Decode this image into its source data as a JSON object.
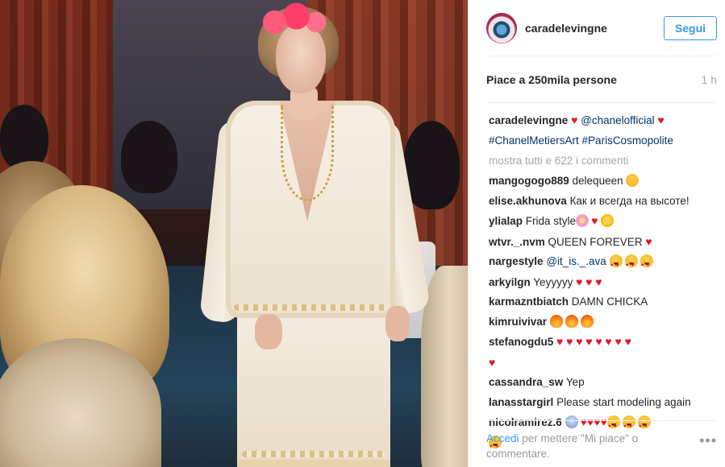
{
  "header": {
    "username": "caradelevingne",
    "follow_label": "Segui"
  },
  "likes": {
    "text": "Piace a 250mila persone",
    "time": "1 h"
  },
  "caption": {
    "username": "caradelevingne",
    "mention": "@chanelofficial",
    "tags": "#ChanelMetiersArt #ParisCosmopolite"
  },
  "more_comments": "mostra tutti e 622 i commenti",
  "comments": [
    {
      "user": "mangogogo889",
      "text": "delequeen"
    },
    {
      "user": "elise.akhunova",
      "text": "Как и всегда на высоте!"
    },
    {
      "user": "ylialap",
      "text": "Frida style"
    },
    {
      "user": "wtvr._.nvm",
      "text": "QUEEN FOREVER"
    },
    {
      "user": "nargestyle",
      "text": "@it_is._.ava"
    },
    {
      "user": "arkyilgn",
      "text": "Yeyyyyy"
    },
    {
      "user": "karmazntbiatch",
      "text": "DAMN CHICKA"
    },
    {
      "user": "kimruivivar",
      "text": ""
    },
    {
      "user": "stefanogdu5",
      "text": ""
    },
    {
      "user": "cassandra_sw",
      "text": "Yep"
    },
    {
      "user": "lanasstargirl",
      "text": "Please start modeling again"
    },
    {
      "user": "nicolramirez.6",
      "text": ""
    }
  ],
  "footer": {
    "login_link": "Accedi",
    "login_text": " per mettere \"Mi piace\" o commentare.",
    "more_icon": "•••"
  },
  "icons": {
    "heart": "♥"
  }
}
